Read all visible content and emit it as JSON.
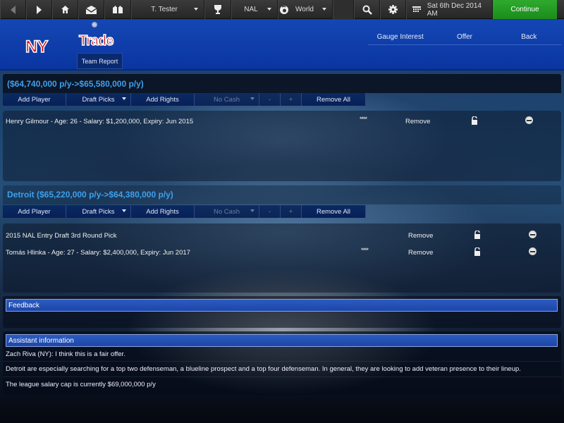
{
  "topbar": {
    "back_icon": "back-arrow-icon",
    "forward_icon": "forward-arrow-icon",
    "home_icon": "home-icon",
    "mail_icon": "mail-icon",
    "jersey_icon": "jersey-icon",
    "manager": "T. Tester",
    "trophy_icon": "trophy-icon",
    "league": "NAL",
    "world": "World",
    "search_icon": "search-icon",
    "settings_icon": "gear-icon",
    "date": "Sat 6th Dec 2014 AM",
    "continue": "Continue"
  },
  "header": {
    "team_abbr": "NY",
    "title": "Trade",
    "team_report": "Team Report",
    "actions": [
      "Gauge Interest",
      "Offer",
      "Back"
    ]
  },
  "buttons": {
    "add_player": "Add Player",
    "draft_picks": "Draft Picks",
    "add_rights": "Add Rights",
    "no_cash": "No Cash",
    "minus": "-",
    "plus": "+",
    "remove_all": "Remove All"
  },
  "ny_side": {
    "title": "($64,740,000 p/y->$65,580,000 p/y)",
    "items": [
      {
        "desc": "Henry Gilmour - Age: 26 - Salary: $1,200,000, Expiry: Jun 2015",
        "rating": "****",
        "remove": "Remove"
      }
    ]
  },
  "det_side": {
    "title": "Detroit ($65,220,000 p/y->$64,380,000 p/y)",
    "items": [
      {
        "desc": "2015 NAL Entry Draft 3rd Round Pick",
        "rating": "",
        "remove": "Remove"
      },
      {
        "desc": "Tomás Hlinka - Age: 27 - Salary: $2,400,000, Expiry: Jun 2017",
        "rating": "****",
        "remove": "Remove"
      }
    ]
  },
  "feedback": {
    "title": "Feedback"
  },
  "assistant": {
    "title": "Assistant information",
    "lines": [
      "Zach Riva (NY): I think this is a fair offer.",
      "Detroit are especially searching for a top two defenseman, a blueline prospect and a top four defenseman. In general, they are looking to add veteran presence to their lineup.",
      "The league salary cap is currently $69,000,000 p/y"
    ]
  },
  "colors": {
    "accent_green": "#1f961f",
    "header_blue": "#0f3fae",
    "team_red": "#d0101a",
    "title_blue": "#3da0ec"
  }
}
